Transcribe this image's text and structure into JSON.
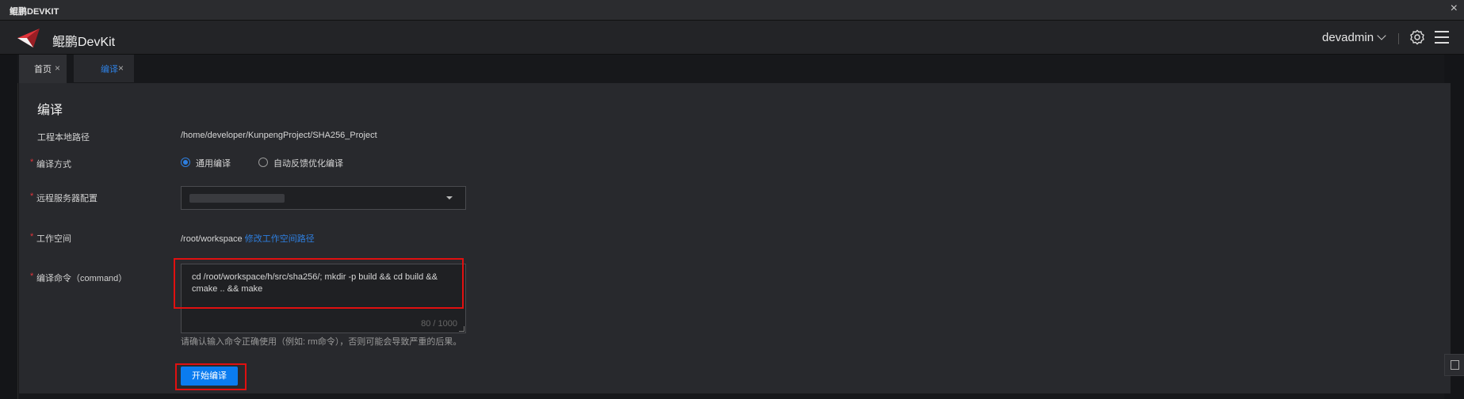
{
  "window": {
    "title": "鲲鹏DEVKIT",
    "close_glyph": "×"
  },
  "header": {
    "brand": "鲲鹏DevKit",
    "user": "devadmin",
    "accent_logo": "#e0343b"
  },
  "tabs": [
    {
      "label": "首页",
      "close": "×",
      "active": false
    },
    {
      "label": "编译",
      "close": "×",
      "active": true
    }
  ],
  "panel": {
    "title": "编译",
    "fields": {
      "project_path_label": "工程本地路径",
      "project_path_value": "/home/developer/KunpengProject/SHA256_Project",
      "compile_mode_label": "编译方式",
      "compile_mode_options": [
        "通用编译",
        "自动反馈优化编译"
      ],
      "compile_mode_selected": "通用编译",
      "remote_server_label": "远程服务器配置",
      "workspace_label": "工作空间",
      "workspace_value": "/root/workspace",
      "workspace_link": "修改工作空间路径",
      "command_label": "编译命令（command）",
      "command_value": "cd /root/workspace/h/src/sha256/; mkdir -p build && cd build && cmake .. && make",
      "command_counter": "80 / 1000",
      "command_hint": "请确认输入命令正确使用（例如: rm命令），否则可能会导致严重的后果。",
      "required_mark": "*"
    },
    "start_button": "开始编译"
  },
  "colors": {
    "accent_blue": "#0a7cf0",
    "link_blue": "#2e7fe0",
    "highlight_red": "#e01010",
    "panel_bg": "#28292d"
  },
  "icons": [
    "kunpeng-logo-icon",
    "chevron-down-icon",
    "gear-icon",
    "menu-icon",
    "close-icon",
    "caret-down-icon",
    "edit-note-icon"
  ]
}
